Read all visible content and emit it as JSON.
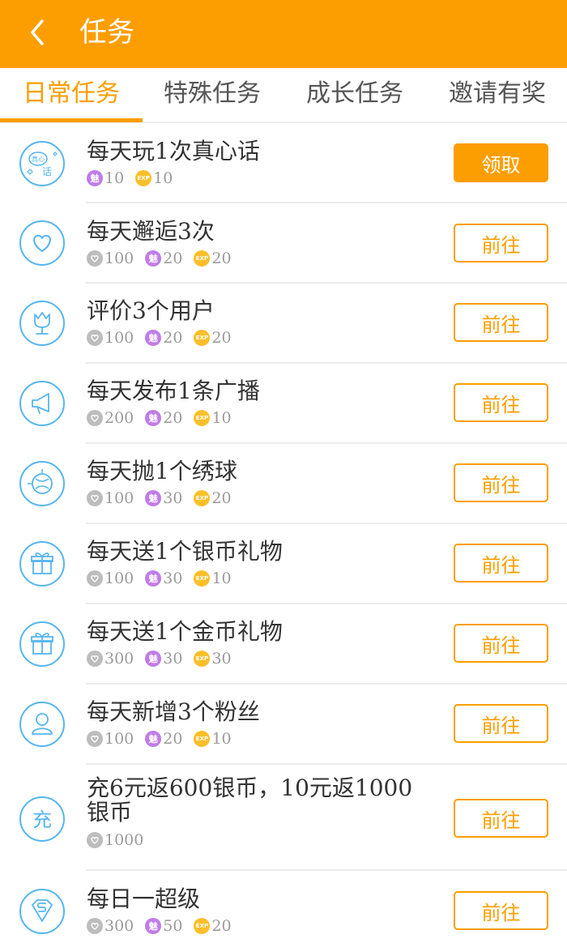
{
  "header": {
    "title": "任务",
    "back_icon": "chevron-left-icon"
  },
  "tabs": [
    {
      "label": "日常任务",
      "active": true
    },
    {
      "label": "特殊任务",
      "active": false
    },
    {
      "label": "成长任务",
      "active": false
    },
    {
      "label": "邀请有奖",
      "active": false
    }
  ],
  "colors": {
    "accent": "#fd9e00",
    "icon_blue": "#55b6f0",
    "charm": "#c07ce8",
    "exp": "#fbbf2a",
    "silver": "#bdbdbd"
  },
  "reward_badges": {
    "charm": "魅",
    "exp": "EXP"
  },
  "tasks": [
    {
      "icon": "truth-talk-icon",
      "title": "每天玩1次真心话",
      "charm": "10",
      "exp": "10",
      "button": "领取",
      "button_state": "claimable"
    },
    {
      "icon": "heart-icon",
      "title": "每天邂逅3次",
      "silver": "100",
      "charm": "20",
      "exp": "20",
      "button": "前往"
    },
    {
      "icon": "tulip-icon",
      "title": "评价3个用户",
      "silver": "100",
      "charm": "20",
      "exp": "20",
      "button": "前往"
    },
    {
      "icon": "megaphone-icon",
      "title": "每天发布1条广播",
      "silver": "200",
      "charm": "20",
      "exp": "10",
      "button": "前往"
    },
    {
      "icon": "ball-icon",
      "title": "每天抛1个绣球",
      "silver": "100",
      "charm": "30",
      "exp": "20",
      "button": "前往"
    },
    {
      "icon": "gift-icon",
      "title": "每天送1个银币礼物",
      "silver": "100",
      "charm": "30",
      "exp": "10",
      "button": "前往"
    },
    {
      "icon": "gift-icon",
      "title": "每天送1个金币礼物",
      "silver": "300",
      "charm": "30",
      "exp": "30",
      "button": "前往"
    },
    {
      "icon": "user-icon",
      "title": "每天新增3个粉丝",
      "silver": "100",
      "charm": "20",
      "exp": "10",
      "button": "前往"
    },
    {
      "icon": "recharge-icon",
      "icon_text": "充",
      "title": "充6元返600银币，10元返1000银币",
      "silver": "1000",
      "button": "前往"
    },
    {
      "icon": "superman-icon",
      "title": "每日一超级",
      "silver": "300",
      "charm": "50",
      "exp": "20",
      "button": "前往"
    }
  ]
}
